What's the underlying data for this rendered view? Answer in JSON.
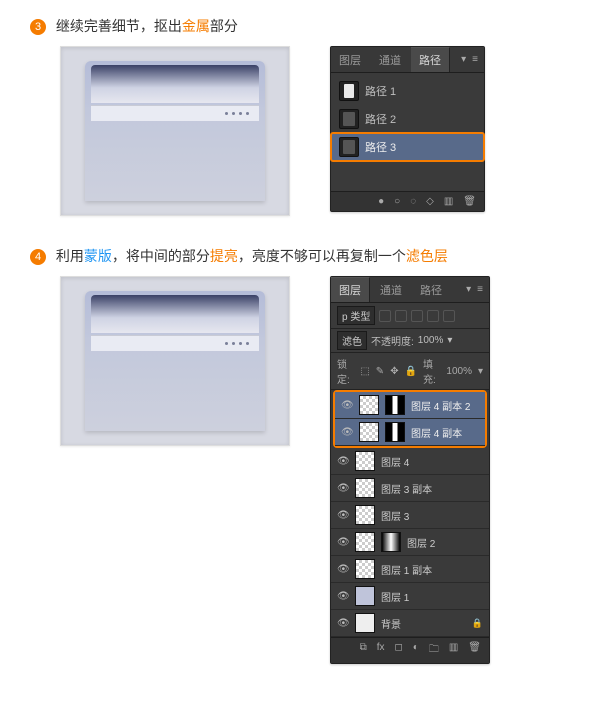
{
  "step3": {
    "num": "3",
    "text_parts": [
      "继续完善细节，抠出",
      "金属",
      "部分"
    ]
  },
  "step4": {
    "num": "4",
    "text_parts": [
      "利用",
      "蒙版",
      "，将中间的部分",
      "提亮",
      "，亮度不够可以再复制一个",
      "滤色层"
    ]
  },
  "paths_panel": {
    "tabs": [
      "图层",
      "通道",
      "路径"
    ],
    "active_tab_index": 2,
    "items": [
      {
        "label": "路径 1",
        "thumb": "white"
      },
      {
        "label": "路径 2",
        "thumb": "dark"
      },
      {
        "label": "路径 3",
        "thumb": "dark",
        "selected": true,
        "marked": true
      }
    ]
  },
  "layers_panel": {
    "tabs": [
      "图层",
      "通道",
      "路径"
    ],
    "active_tab_index": 0,
    "kind_label": "p 类型",
    "blend_mode": "滤色",
    "opacity_label": "不透明度:",
    "opacity_value": "100%",
    "fill_label": "填充:",
    "fill_value": "100%",
    "lock_label": "锁定:",
    "layers": [
      {
        "name": "图层 4 副本 2",
        "thumb": "checker",
        "mask": "strip",
        "selected": true,
        "marked": true
      },
      {
        "name": "图层 4 副本",
        "thumb": "checker",
        "mask": "strip",
        "selected": true,
        "marked": true
      },
      {
        "name": "图层 4",
        "thumb": "checker",
        "mask": "none"
      },
      {
        "name": "图层 3 副本",
        "thumb": "checker",
        "mask": "none"
      },
      {
        "name": "图层 3",
        "thumb": "checker",
        "mask": "none"
      },
      {
        "name": "图层 2",
        "thumb": "checker",
        "mask": "grad"
      },
      {
        "name": "图层 1 副本",
        "thumb": "checker",
        "mask": "none"
      },
      {
        "name": "图层 1",
        "thumb": "solid",
        "mask": "none"
      },
      {
        "name": "背景",
        "thumb": "white",
        "mask": "none",
        "locked": true
      }
    ]
  }
}
